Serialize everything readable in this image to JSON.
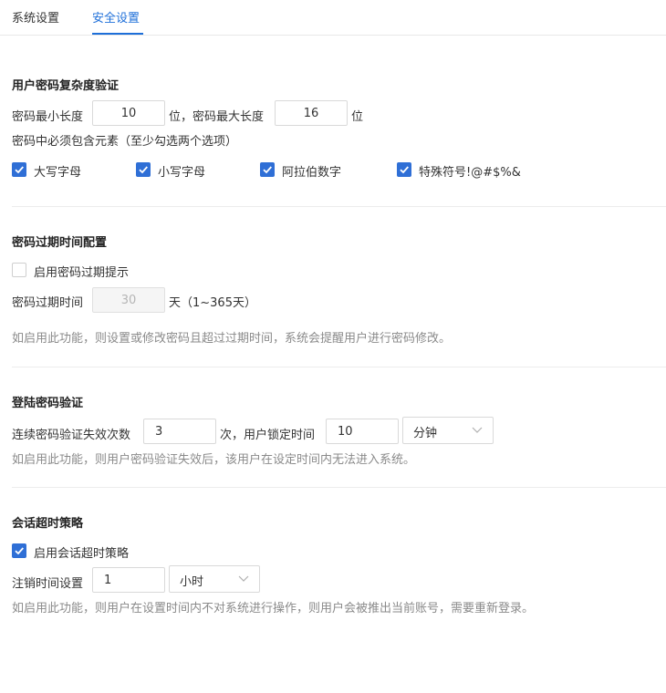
{
  "tabs": {
    "system": "系统设置",
    "security": "安全设置"
  },
  "password_complexity": {
    "title": "用户密码复杂度验证",
    "min_label": "密码最小长度",
    "min_value": "10",
    "unit_mid": "位，密码最大长度",
    "max_value": "16",
    "unit_end": "位",
    "requirement": "密码中必须包含元素（至少勾选两个选项）",
    "options": [
      {
        "label": "大写字母",
        "checked": true
      },
      {
        "label": "小写字母",
        "checked": true
      },
      {
        "label": "阿拉伯数字",
        "checked": true
      },
      {
        "label": "特殊符号!@#$%&",
        "checked": true
      }
    ]
  },
  "password_expiry": {
    "title": "密码过期时间配置",
    "enable_label": "启用密码过期提示",
    "enabled": false,
    "time_label": "密码过期时间",
    "time_value": "30",
    "time_unit": "天（1~365天）",
    "hint": "如启用此功能，则设置或修改密码且超过过期时间，系统会提醒用户进行密码修改。"
  },
  "login_verify": {
    "title": "登陆密码验证",
    "fail_label": "连续密码验证失效次数",
    "fail_value": "3",
    "lock_label": "次，用户锁定时间",
    "lock_value": "10",
    "lock_unit": "分钟",
    "hint": "如启用此功能，则用户密码验证失效后，该用户在设定时间内无法进入系统。"
  },
  "session_timeout": {
    "title": "会话超时策略",
    "enable_label": "启用会话超时策略",
    "enabled": true,
    "logout_label": "注销时间设置",
    "logout_value": "1",
    "logout_unit": "小时",
    "hint": "如启用此功能，则用户在设置时间内不对系统进行操作，则用户会被推出当前账号，需要重新登录。"
  },
  "colors": {
    "accent": "#2f6fd6",
    "tab_active": "#1e6fd9",
    "hint": "#8a8a8a"
  }
}
